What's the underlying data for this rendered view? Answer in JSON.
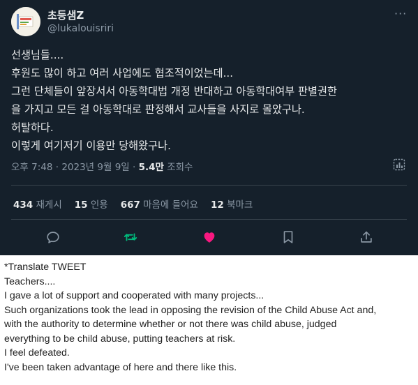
{
  "tweet": {
    "display_name": "초등샘Z",
    "handle": "@lukalouisriri",
    "more_glyph": "···",
    "body_lines": [
      "선생님들....",
      "후원도 많이 하고 여러 사업에도 협조적이었는데...",
      "그런 단체들이 앞장서서 아동학대법 개정 반대하고 아동학대여부 판별권한",
      "을 가지고 모든 걸 아동학대로 판정해서 교사들을 사지로 몰았구나.",
      "허탈하다.",
      "이렇게 여기저기 이용만 당해왔구나."
    ],
    "timestamp": "오후 7:48 · 2023년 9월 9일 · ",
    "views_count": "5.4만",
    "views_label": " 조회수",
    "stats": {
      "reposts_count": "434",
      "reposts_label": " 재게시",
      "quotes_count": "15",
      "quotes_label": " 인용",
      "likes_count": "667",
      "likes_label": " 마음에 들어요",
      "bookmarks_count": "12",
      "bookmarks_label": " 북마크"
    },
    "icons": {
      "reply": "reply-icon",
      "retweet": "retweet-icon",
      "like": "heart-icon",
      "bookmark": "bookmark-icon",
      "share": "share-icon",
      "analytics": "analytics-icon"
    },
    "colors": {
      "background": "#15202b",
      "retweet_active": "#00ba7c",
      "like_active": "#f91880"
    }
  },
  "translation": {
    "lines": [
      "*Translate TWEET",
      "Teachers....",
      "I gave a lot of support and cooperated with many projects...",
      "Such organizations took the lead in opposing the revision of the Child Abuse Act and,",
      "with the authority to determine whether or not there was child abuse, judged",
      "everything to be child abuse, putting teachers at risk.",
      "I feel defeated.",
      "I've been taken advantage of here and there like this."
    ]
  }
}
